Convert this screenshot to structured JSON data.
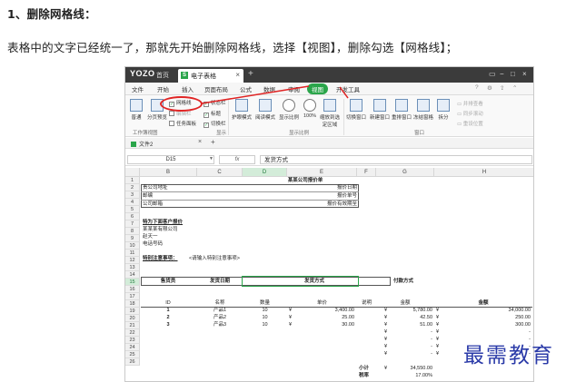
{
  "article": {
    "heading": "1、删除网格线：",
    "paragraph": "表格中的文字已经统一了，那就先开始删除网格线，选择【视图】，删除勾选【网格线】；"
  },
  "app": {
    "logo": "YOZO",
    "home_tab": "首页",
    "doc_tab": "电子表格",
    "menu": [
      "文件",
      "开始",
      "插入",
      "页面布局",
      "公式",
      "数据",
      "审阅",
      "视图",
      "开发工具"
    ],
    "active_menu": "视图"
  },
  "ribbon": {
    "normal": "普通",
    "page_break": "分页预览",
    "gridlines": "网格线",
    "status_bar": "状态栏",
    "edit_bar": "编辑栏",
    "headings": "标题",
    "task_pane": "任务面板",
    "switch_bar": "切换栏",
    "group_workbook_views": "工作簿视图",
    "group_show": "显示",
    "full_screen": "护眼模式",
    "read_mode": "阅读模式",
    "zoom": "显示比例",
    "zoom_100": "100%",
    "zoom_to_sel": "缩放到选定区域",
    "switch_window": "切换窗口",
    "new_window": "新建窗口",
    "arrange": "重排窗口",
    "freeze": "冻结窗格",
    "split": "拆分",
    "side_by_side": "并排查看",
    "sync_scroll": "同步滚动",
    "reset_pos": "重设位置",
    "group_zoom": "显示比例",
    "group_window": "窗口"
  },
  "sheet_tab": "文件2",
  "formula_bar": {
    "name_box": "D15",
    "fx": "fx",
    "content": "发货方式"
  },
  "columns": [
    "B",
    "C",
    "D",
    "E",
    "F",
    "G",
    "H"
  ],
  "selected_column": "D",
  "rows": [
    "1",
    "2",
    "3",
    "4",
    "5",
    "6",
    "7",
    "8",
    "9",
    "10",
    "11",
    "12",
    "13",
    "14",
    "15",
    "16",
    "17",
    "18",
    "19",
    "20",
    "21",
    "22",
    "23",
    "24",
    "25",
    "26"
  ],
  "sheet": {
    "title": "某某公司报价单",
    "company_address": "贵公司地址",
    "postcode": "邮编",
    "company_phone": "公司邮箱",
    "quote_date": "报价日期",
    "quote_no": "报价单号",
    "valid_until": "报价有效期至",
    "customer_info": "特为下面客户报价",
    "customer_company": "某某某有限公司",
    "customer_name": "赵天一",
    "phone": "电话号码",
    "notes_label": "特别注意事项：",
    "notes_value": "<请输入特别注意事项>",
    "header_row": [
      "售货员",
      "发货日期",
      "发货方式",
      "付款方式"
    ],
    "item_headers": [
      "ID",
      "名称",
      "数量",
      "单价",
      "说明",
      "金额",
      "金额"
    ],
    "items": [
      {
        "id": "1",
        "name": "产品1",
        "qty": "10",
        "cur": "¥",
        "price": "3,400.00",
        "cur2": "¥",
        "amount": "5,780.00",
        "cur3": "¥",
        "total": "34,000.00"
      },
      {
        "id": "2",
        "name": "产品2",
        "qty": "10",
        "cur": "¥",
        "price": "25.00",
        "cur2": "¥",
        "amount": "42.50",
        "cur3": "¥",
        "total": "250.00"
      },
      {
        "id": "3",
        "name": "产品3",
        "qty": "10",
        "cur": "¥",
        "price": "30.00",
        "cur2": "¥",
        "amount": "51.00",
        "cur3": "¥",
        "total": "300.00"
      }
    ],
    "empty_currency": "¥",
    "dash": "-",
    "subtotal_label": "小计",
    "subtotal_cur": "¥",
    "subtotal_value": "34,550.00",
    "tax_label": "税率",
    "tax_value": "17.00%"
  },
  "watermark": "最需教育",
  "colors": {
    "accent": "#2aa54a",
    "annotation": "#e02424",
    "titlebar": "#3b3b3b",
    "watermark": "#2a3aa8"
  }
}
